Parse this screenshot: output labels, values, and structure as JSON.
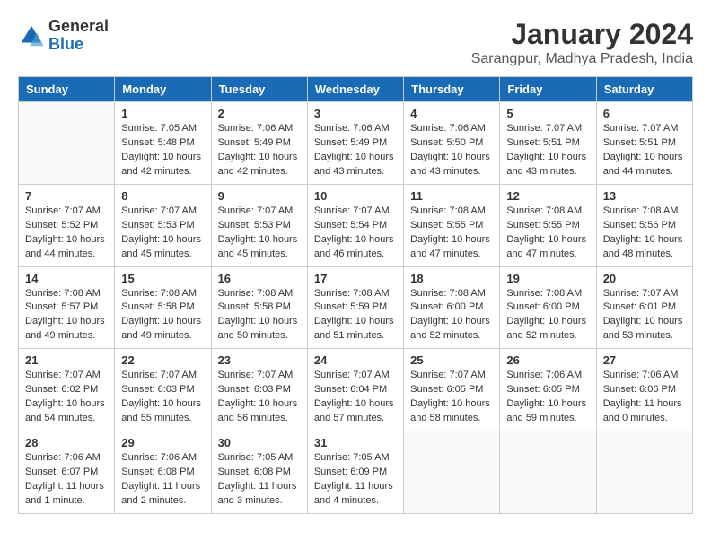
{
  "logo": {
    "general": "General",
    "blue": "Blue"
  },
  "title": "January 2024",
  "subtitle": "Sarangpur, Madhya Pradesh, India",
  "days_of_week": [
    "Sunday",
    "Monday",
    "Tuesday",
    "Wednesday",
    "Thursday",
    "Friday",
    "Saturday"
  ],
  "weeks": [
    [
      {
        "day": "",
        "info": ""
      },
      {
        "day": "1",
        "info": "Sunrise: 7:05 AM\nSunset: 5:48 PM\nDaylight: 10 hours\nand 42 minutes."
      },
      {
        "day": "2",
        "info": "Sunrise: 7:06 AM\nSunset: 5:49 PM\nDaylight: 10 hours\nand 42 minutes."
      },
      {
        "day": "3",
        "info": "Sunrise: 7:06 AM\nSunset: 5:49 PM\nDaylight: 10 hours\nand 43 minutes."
      },
      {
        "day": "4",
        "info": "Sunrise: 7:06 AM\nSunset: 5:50 PM\nDaylight: 10 hours\nand 43 minutes."
      },
      {
        "day": "5",
        "info": "Sunrise: 7:07 AM\nSunset: 5:51 PM\nDaylight: 10 hours\nand 43 minutes."
      },
      {
        "day": "6",
        "info": "Sunrise: 7:07 AM\nSunset: 5:51 PM\nDaylight: 10 hours\nand 44 minutes."
      }
    ],
    [
      {
        "day": "7",
        "info": "Sunrise: 7:07 AM\nSunset: 5:52 PM\nDaylight: 10 hours\nand 44 minutes."
      },
      {
        "day": "8",
        "info": "Sunrise: 7:07 AM\nSunset: 5:53 PM\nDaylight: 10 hours\nand 45 minutes."
      },
      {
        "day": "9",
        "info": "Sunrise: 7:07 AM\nSunset: 5:53 PM\nDaylight: 10 hours\nand 45 minutes."
      },
      {
        "day": "10",
        "info": "Sunrise: 7:07 AM\nSunset: 5:54 PM\nDaylight: 10 hours\nand 46 minutes."
      },
      {
        "day": "11",
        "info": "Sunrise: 7:08 AM\nSunset: 5:55 PM\nDaylight: 10 hours\nand 47 minutes."
      },
      {
        "day": "12",
        "info": "Sunrise: 7:08 AM\nSunset: 5:55 PM\nDaylight: 10 hours\nand 47 minutes."
      },
      {
        "day": "13",
        "info": "Sunrise: 7:08 AM\nSunset: 5:56 PM\nDaylight: 10 hours\nand 48 minutes."
      }
    ],
    [
      {
        "day": "14",
        "info": "Sunrise: 7:08 AM\nSunset: 5:57 PM\nDaylight: 10 hours\nand 49 minutes."
      },
      {
        "day": "15",
        "info": "Sunrise: 7:08 AM\nSunset: 5:58 PM\nDaylight: 10 hours\nand 49 minutes."
      },
      {
        "day": "16",
        "info": "Sunrise: 7:08 AM\nSunset: 5:58 PM\nDaylight: 10 hours\nand 50 minutes."
      },
      {
        "day": "17",
        "info": "Sunrise: 7:08 AM\nSunset: 5:59 PM\nDaylight: 10 hours\nand 51 minutes."
      },
      {
        "day": "18",
        "info": "Sunrise: 7:08 AM\nSunset: 6:00 PM\nDaylight: 10 hours\nand 52 minutes."
      },
      {
        "day": "19",
        "info": "Sunrise: 7:08 AM\nSunset: 6:00 PM\nDaylight: 10 hours\nand 52 minutes."
      },
      {
        "day": "20",
        "info": "Sunrise: 7:07 AM\nSunset: 6:01 PM\nDaylight: 10 hours\nand 53 minutes."
      }
    ],
    [
      {
        "day": "21",
        "info": "Sunrise: 7:07 AM\nSunset: 6:02 PM\nDaylight: 10 hours\nand 54 minutes."
      },
      {
        "day": "22",
        "info": "Sunrise: 7:07 AM\nSunset: 6:03 PM\nDaylight: 10 hours\nand 55 minutes."
      },
      {
        "day": "23",
        "info": "Sunrise: 7:07 AM\nSunset: 6:03 PM\nDaylight: 10 hours\nand 56 minutes."
      },
      {
        "day": "24",
        "info": "Sunrise: 7:07 AM\nSunset: 6:04 PM\nDaylight: 10 hours\nand 57 minutes."
      },
      {
        "day": "25",
        "info": "Sunrise: 7:07 AM\nSunset: 6:05 PM\nDaylight: 10 hours\nand 58 minutes."
      },
      {
        "day": "26",
        "info": "Sunrise: 7:06 AM\nSunset: 6:05 PM\nDaylight: 10 hours\nand 59 minutes."
      },
      {
        "day": "27",
        "info": "Sunrise: 7:06 AM\nSunset: 6:06 PM\nDaylight: 11 hours\nand 0 minutes."
      }
    ],
    [
      {
        "day": "28",
        "info": "Sunrise: 7:06 AM\nSunset: 6:07 PM\nDaylight: 11 hours\nand 1 minute."
      },
      {
        "day": "29",
        "info": "Sunrise: 7:06 AM\nSunset: 6:08 PM\nDaylight: 11 hours\nand 2 minutes."
      },
      {
        "day": "30",
        "info": "Sunrise: 7:05 AM\nSunset: 6:08 PM\nDaylight: 11 hours\nand 3 minutes."
      },
      {
        "day": "31",
        "info": "Sunrise: 7:05 AM\nSunset: 6:09 PM\nDaylight: 11 hours\nand 4 minutes."
      },
      {
        "day": "",
        "info": ""
      },
      {
        "day": "",
        "info": ""
      },
      {
        "day": "",
        "info": ""
      }
    ]
  ]
}
